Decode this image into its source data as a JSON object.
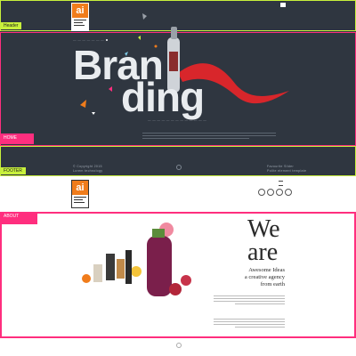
{
  "sections": {
    "header": "Header",
    "home": "HOME",
    "footer": "FOOTER",
    "about": "ABOUT"
  },
  "logo": {
    "mark": "ai"
  },
  "hero": {
    "line1": "Bran",
    "line2": "ding",
    "footer_left_1": "© Copyright 2015",
    "footer_left_2": "Lorem technology",
    "footer_right_1": "Favourite Slider",
    "footer_right_2": "Polite element template"
  },
  "about": {
    "we": "We",
    "are": "are",
    "tagline_1": "Awesome Ideas",
    "tagline_2": "a creative agency",
    "tagline_3": "from earth"
  },
  "colors": {
    "dark_bg": "#2f3640",
    "lime": "#c8f03c",
    "pink": "#ff2e7e",
    "orange": "#f07c1b",
    "ribbon": "#d8262b",
    "bottle": "#7a1f4b"
  }
}
